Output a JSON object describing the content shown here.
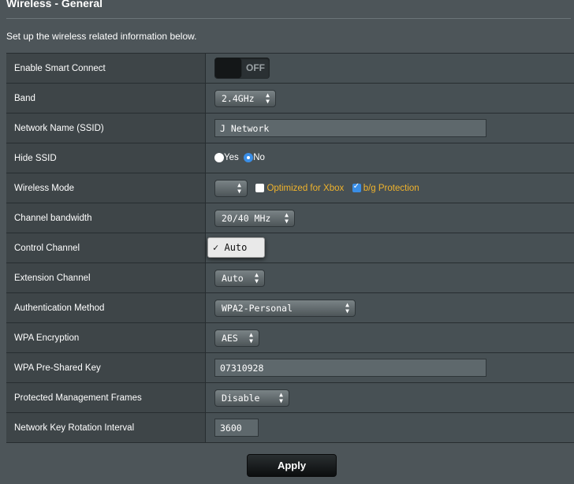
{
  "header": {
    "title": "Wireless - General",
    "intro": "Set up the wireless related information below."
  },
  "fields": {
    "smart_connect": {
      "label": "Enable Smart Connect",
      "state": "OFF"
    },
    "band": {
      "label": "Band",
      "value": "2.4GHz"
    },
    "ssid": {
      "label": "Network Name (SSID)",
      "value": "J Network"
    },
    "hide_ssid": {
      "label": "Hide SSID",
      "options": [
        "Yes",
        "No"
      ],
      "selected": "No"
    },
    "wireless_mode": {
      "label": "Wireless Mode",
      "value": "",
      "xbox_label": "Optimized for Xbox",
      "xbox_checked": false,
      "bg_label": "b/g Protection",
      "bg_checked": true
    },
    "channel_bandwidth": {
      "label": "Channel bandwidth",
      "value": "20/40 MHz"
    },
    "control_channel": {
      "label": "Control Channel",
      "open_option": "Auto",
      "checkmark": "✓"
    },
    "extension_channel": {
      "label": "Extension Channel",
      "value": "Auto"
    },
    "auth_method": {
      "label": "Authentication Method",
      "value": "WPA2-Personal"
    },
    "wpa_encryption": {
      "label": "WPA Encryption",
      "value": "AES"
    },
    "wpa_key": {
      "label": "WPA Pre-Shared Key",
      "value": "07310928"
    },
    "pmf": {
      "label": "Protected Management Frames",
      "value": "Disable"
    },
    "key_rotation": {
      "label": "Network Key Rotation Interval",
      "value": "3600"
    }
  },
  "actions": {
    "apply_label": "Apply"
  },
  "colors": {
    "accent_orange": "#f0b32c",
    "accent_blue": "#3a8ee6",
    "background": "#4d5559"
  }
}
